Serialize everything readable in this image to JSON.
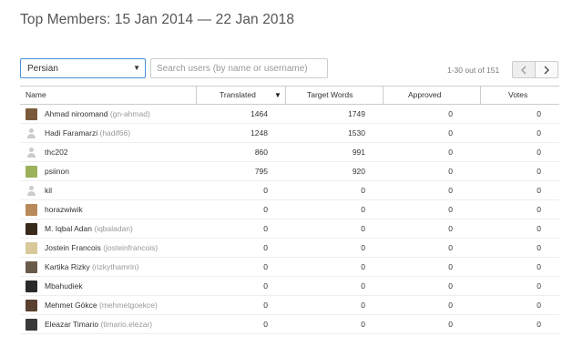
{
  "page": {
    "title": "Top Members: 15 Jan 2014 — 22 Jan 2018"
  },
  "filters": {
    "language": "Persian",
    "search_placeholder": "Search users (by name or username)"
  },
  "pagination": {
    "text": "1-30 out of 151",
    "prev_icon": "chevron-left-icon",
    "next_icon": "chevron-right-icon"
  },
  "table": {
    "columns": [
      "Name",
      "Translated",
      "Target Words",
      "Approved",
      "Votes"
    ],
    "sort_indicator": "▼",
    "rows": [
      {
        "name": "Ahmad niroomand",
        "username": "(gn-ahmad)",
        "translated": "1464",
        "target_words": "1749",
        "approved": "0",
        "votes": "0",
        "avatar_color": "#7a5a3a"
      },
      {
        "name": "Hadi Faramarzi",
        "username": "(hadif66)",
        "translated": "1248",
        "target_words": "1530",
        "approved": "0",
        "votes": "0",
        "avatar_color": ""
      },
      {
        "name": "thc202",
        "username": "",
        "translated": "860",
        "target_words": "991",
        "approved": "0",
        "votes": "0",
        "avatar_color": ""
      },
      {
        "name": "psiinon",
        "username": "",
        "translated": "795",
        "target_words": "920",
        "approved": "0",
        "votes": "0",
        "avatar_color": "#9bb25a"
      },
      {
        "name": "kil",
        "username": "",
        "translated": "0",
        "target_words": "0",
        "approved": "0",
        "votes": "0",
        "avatar_color": ""
      },
      {
        "name": "horazwiwik",
        "username": "",
        "translated": "0",
        "target_words": "0",
        "approved": "0",
        "votes": "0",
        "avatar_color": "#b88a5a"
      },
      {
        "name": "M. Iqbal Adan",
        "username": "(iqbaladan)",
        "translated": "0",
        "target_words": "0",
        "approved": "0",
        "votes": "0",
        "avatar_color": "#3a2a1a"
      },
      {
        "name": "Jostein Francois",
        "username": "(josteinfrancois)",
        "translated": "0",
        "target_words": "0",
        "approved": "0",
        "votes": "0",
        "avatar_color": "#d8c89a"
      },
      {
        "name": "Kartika Rizky",
        "username": "(rizkythamrin)",
        "translated": "0",
        "target_words": "0",
        "approved": "0",
        "votes": "0",
        "avatar_color": "#6a5a4a"
      },
      {
        "name": "Mbahudiek",
        "username": "",
        "translated": "0",
        "target_words": "0",
        "approved": "0",
        "votes": "0",
        "avatar_color": "#2a2a2a"
      },
      {
        "name": "Mehmet Gökce",
        "username": "(mehmetgoekce)",
        "translated": "0",
        "target_words": "0",
        "approved": "0",
        "votes": "0",
        "avatar_color": "#5a4030"
      },
      {
        "name": "Eleazar Timario",
        "username": "(timario.elezar)",
        "translated": "0",
        "target_words": "0",
        "approved": "0",
        "votes": "0",
        "avatar_color": "#3a3a3a"
      }
    ]
  }
}
